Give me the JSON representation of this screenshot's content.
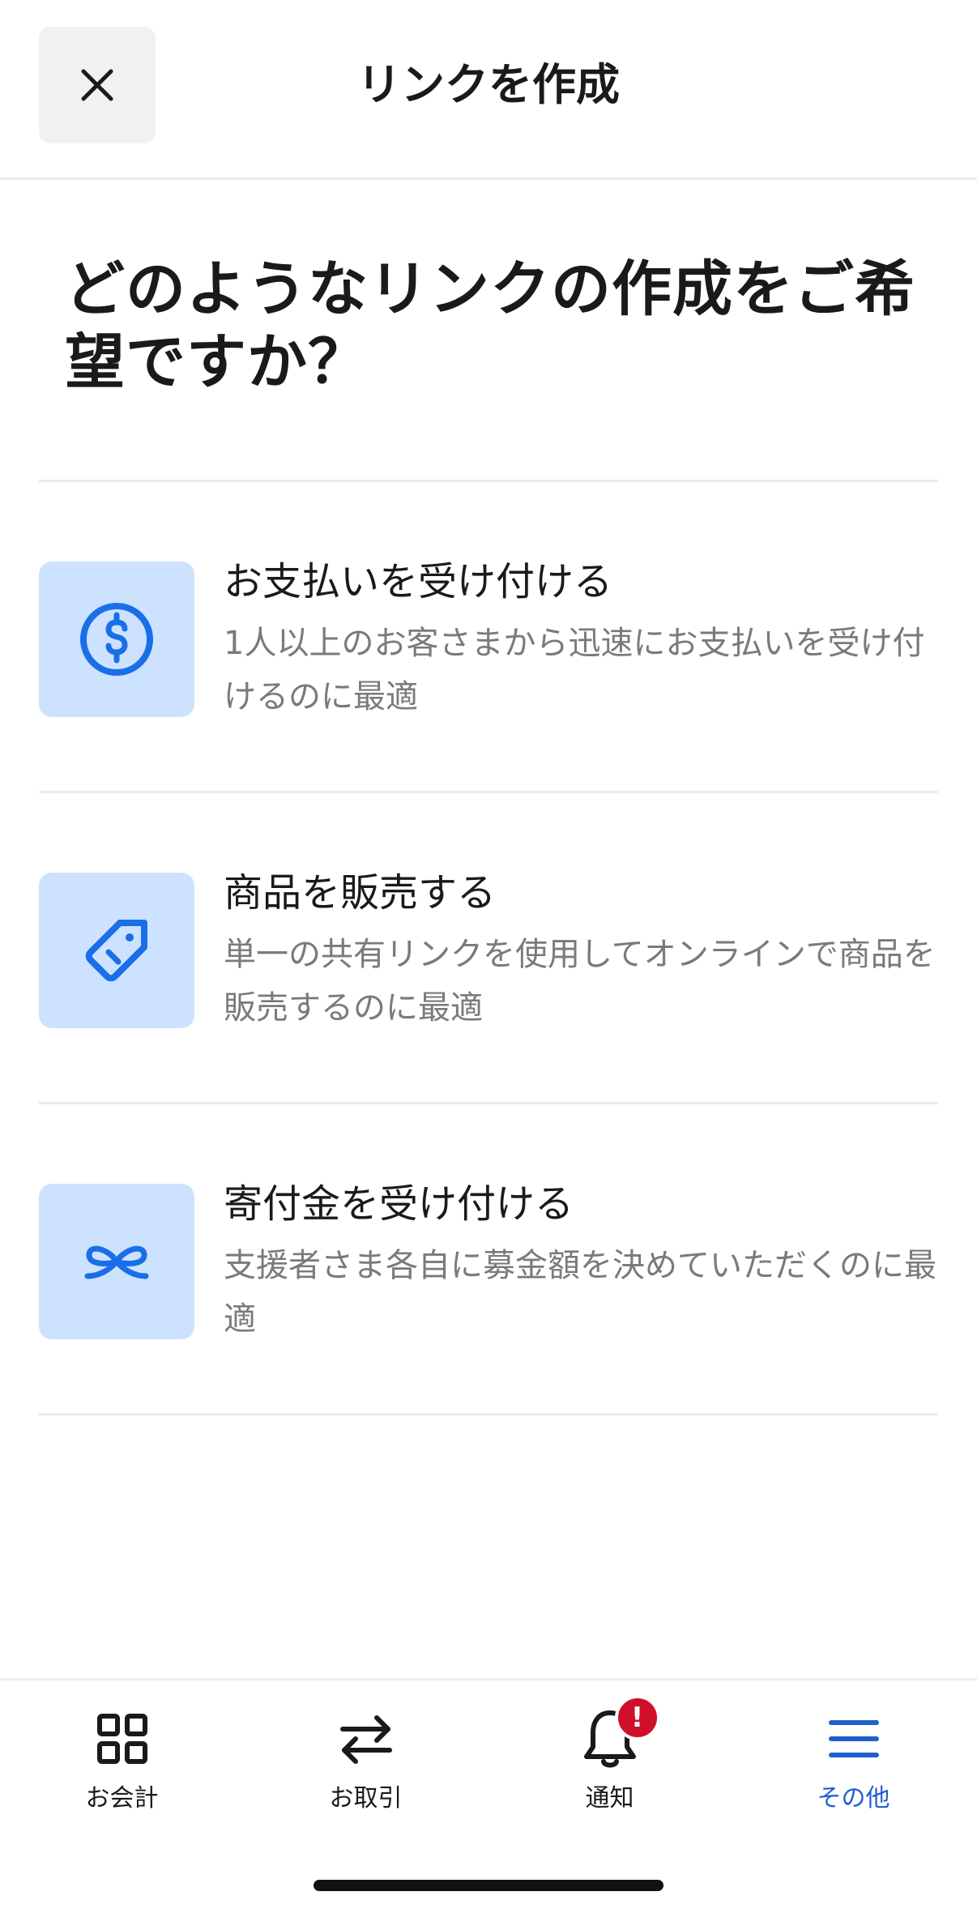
{
  "header": {
    "title": "リンクを作成"
  },
  "question": "どのようなリンクの作成をご希望ですか？",
  "colors": {
    "accent": "#1a6fe8",
    "icon_box_bg": "#cde2fe",
    "badge": "#d0102a",
    "active_nav": "#1f5fd0"
  },
  "options": [
    {
      "icon": "dollar-circle-icon",
      "title": "お支払いを受け付ける",
      "description": "1人以上のお客さまから迅速にお支払いを受け付けるのに最適"
    },
    {
      "icon": "price-tag-icon",
      "title": "商品を販売する",
      "description": "単一の共有リンクを使用してオンラインで商品を販売するのに最適"
    },
    {
      "icon": "ribbon-bow-icon",
      "title": "寄付金を受け付ける",
      "description": "支援者さま各自に募金額を決めていただくのに最適"
    }
  ],
  "nav": {
    "items": [
      {
        "label": "お会計",
        "icon": "grid-icon"
      },
      {
        "label": "お取引",
        "icon": "transfer-arrows-icon"
      },
      {
        "label": "通知",
        "icon": "bell-icon",
        "badge": "!"
      },
      {
        "label": "その他",
        "icon": "menu-icon",
        "active": true
      }
    ]
  }
}
